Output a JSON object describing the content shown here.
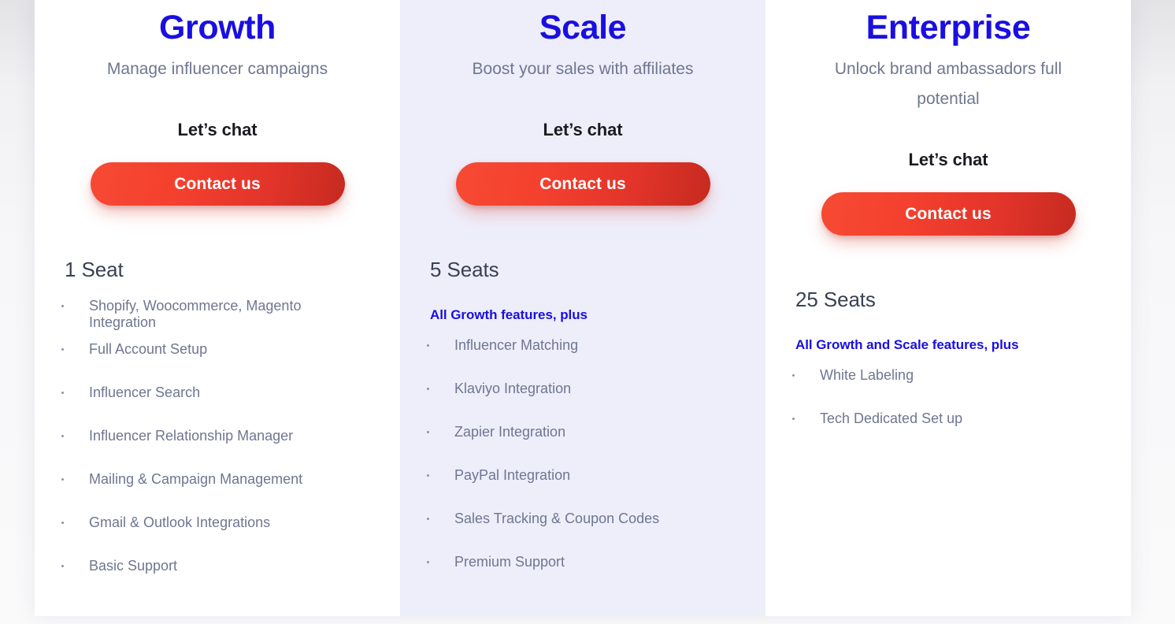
{
  "plans": [
    {
      "id": "growth",
      "title": "Growth",
      "subtitle": "Manage influencer campaigns",
      "cta_label": "Let’s chat",
      "button_label": "Contact us",
      "seats": "1 Seat",
      "plus_line": "",
      "features": [
        "Shopify, Woocommerce, Magento Integration",
        "Full Account Setup",
        "Influencer Search",
        "Influencer Relationship Manager",
        "Mailing & Campaign Management",
        "Gmail & Outlook Integrations",
        "Basic Support"
      ]
    },
    {
      "id": "scale",
      "title": "Scale",
      "subtitle": "Boost your sales with affiliates",
      "cta_label": "Let’s chat",
      "button_label": "Contact us",
      "seats": "5 Seats",
      "plus_line": "All Growth features, plus",
      "features": [
        "Influencer Matching",
        "Klaviyo Integration",
        "Zapier Integration",
        "PayPal Integration",
        "Sales Tracking & Coupon Codes",
        "Premium Support"
      ]
    },
    {
      "id": "enterprise",
      "title": "Enterprise",
      "subtitle": "Unlock brand ambassadors full potential",
      "cta_label": "Let’s chat",
      "button_label": "Contact us",
      "seats": "25 Seats",
      "plus_line": "All Growth and Scale features, plus",
      "features": [
        "White Labeling",
        "Tech Dedicated Set up"
      ]
    }
  ],
  "colors": {
    "brand_blue": "#1a0fe0",
    "button_red_start": "#f64a33",
    "button_red_end": "#c62a1f",
    "body_text": "#6f7691",
    "heading_dark": "#3b4154",
    "featured_bg": "#eeeefa",
    "card_bg": "#ffffff"
  }
}
